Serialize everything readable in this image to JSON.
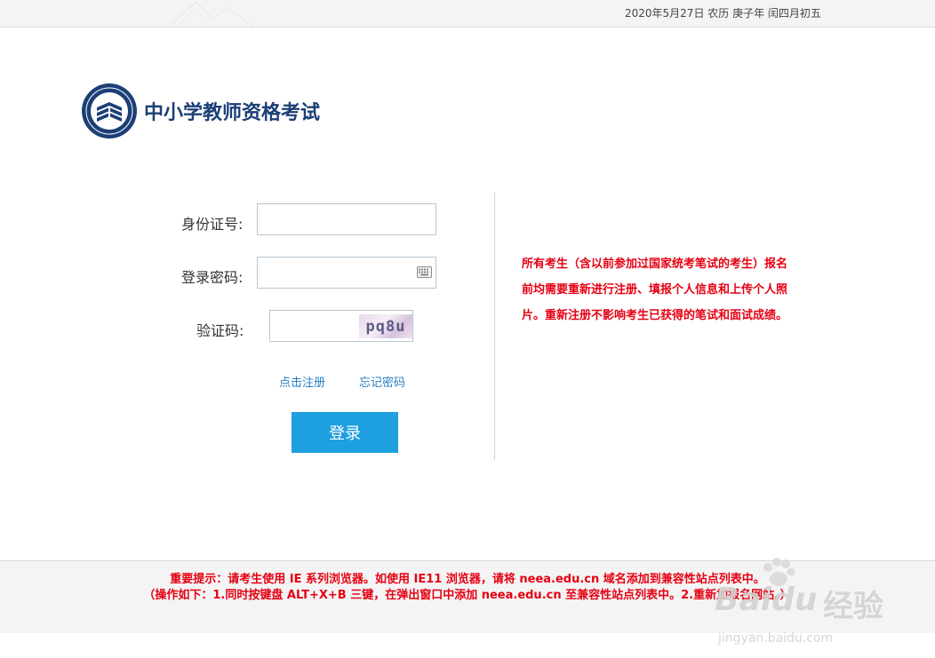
{
  "header": {
    "date_text": "2020年5月27日 农历 庚子年 闰四月初五"
  },
  "brand": {
    "title": "中小学教师资格考试",
    "logo_icon": "teacher-certification-seal-icon"
  },
  "form": {
    "id_label": "身份证号:",
    "id_value": "",
    "password_label": "登录密码:",
    "password_value": "",
    "captcha_label": "验证码:",
    "captcha_value": "",
    "captcha_image_text": "pq8u",
    "register_link": "点击注册",
    "forgot_link": "忘记密码",
    "login_button": "登录"
  },
  "notice": {
    "text": "所有考生（含以前参加过国家统考笔试的考生）报名前均需要重新进行注册、填报个人信息和上传个人照片。重新注册不影响考生已获得的笔试和面试成绩。"
  },
  "footer": {
    "line1": "重要提示：请考生使用 IE 系列浏览器。如使用 IE11 浏览器，请将 neea.edu.cn 域名添加到兼容性站点列表中。",
    "line2": "（操作如下：1.同时按键盘 ALT+X+B 三键，在弹出窗口中添加 neea.edu.cn 至兼容性站点列表中。2.重新加报名网站。）"
  },
  "watermark": {
    "brand": "Baidu",
    "suffix": "经验",
    "url": "jingyan.baidu.com"
  },
  "colors": {
    "accent": "#1e9fe0",
    "brand_dark": "#1b3f77",
    "notice_red": "#e60012",
    "link": "#2a7fc2"
  }
}
